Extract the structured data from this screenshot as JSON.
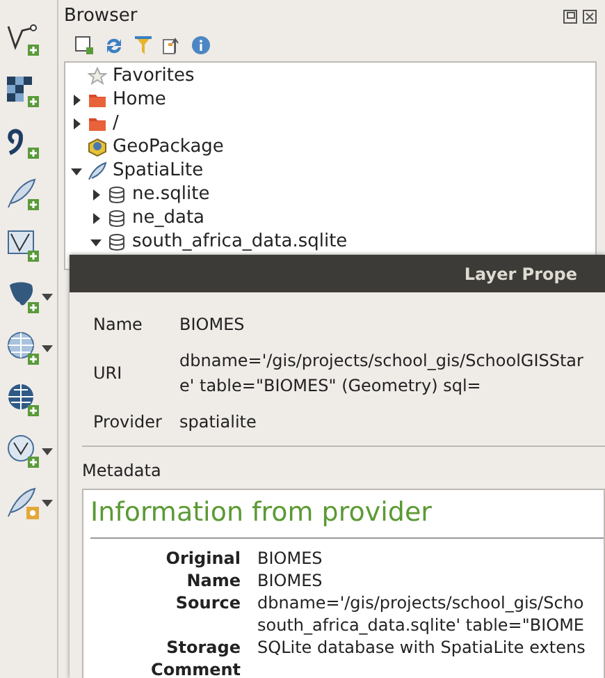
{
  "toolbar": [
    {
      "dropdown": false
    },
    {
      "dropdown": false
    },
    {
      "dropdown": false
    },
    {
      "dropdown": false
    },
    {
      "dropdown": false
    },
    {
      "dropdown": true
    },
    {
      "dropdown": true
    },
    {
      "dropdown": false
    },
    {
      "dropdown": true
    },
    {
      "dropdown": true
    }
  ],
  "browser": {
    "title": "Browser",
    "tree": [
      {
        "label": "Favorites",
        "kind": "star"
      },
      {
        "label": "Home",
        "kind": "folder",
        "expanded": false
      },
      {
        "label": "/",
        "kind": "folder",
        "expanded": false
      },
      {
        "label": "GeoPackage",
        "kind": "geopackage"
      },
      {
        "label": "SpatiaLite",
        "kind": "feather",
        "expanded": true,
        "children": [
          {
            "label": "ne.sqlite",
            "kind": "database",
            "expanded": false
          },
          {
            "label": "ne_data",
            "kind": "database",
            "expanded": false
          },
          {
            "label": "south_africa_data.sqlite",
            "kind": "database",
            "expanded": true
          }
        ]
      }
    ]
  },
  "dialog": {
    "title": "Layer Prope",
    "fields": [
      {
        "label": "Name",
        "lines": [
          "BIOMES"
        ]
      },
      {
        "label": "URI",
        "lines": [
          "dbname='/gis/projects/school_gis/SchoolGISStar",
          "e' table=\"BIOMES\" (Geometry) sql="
        ]
      },
      {
        "label": "Provider",
        "lines": [
          "spatialite"
        ]
      }
    ],
    "metadata_label": "Metadata",
    "heading": "Information from provider",
    "rows": [
      {
        "label": "Original",
        "lines": [
          "BIOMES"
        ]
      },
      {
        "label": "Name",
        "lines": [
          "BIOMES"
        ]
      },
      {
        "label": "Source",
        "lines": [
          "dbname='/gis/projects/school_gis/Scho",
          "south_africa_data.sqlite' table=\"BIOME"
        ]
      },
      {
        "label": "Storage",
        "lines": [
          "SQLite database with SpatiaLite extens"
        ]
      },
      {
        "label": "Comment",
        "lines": []
      }
    ]
  }
}
